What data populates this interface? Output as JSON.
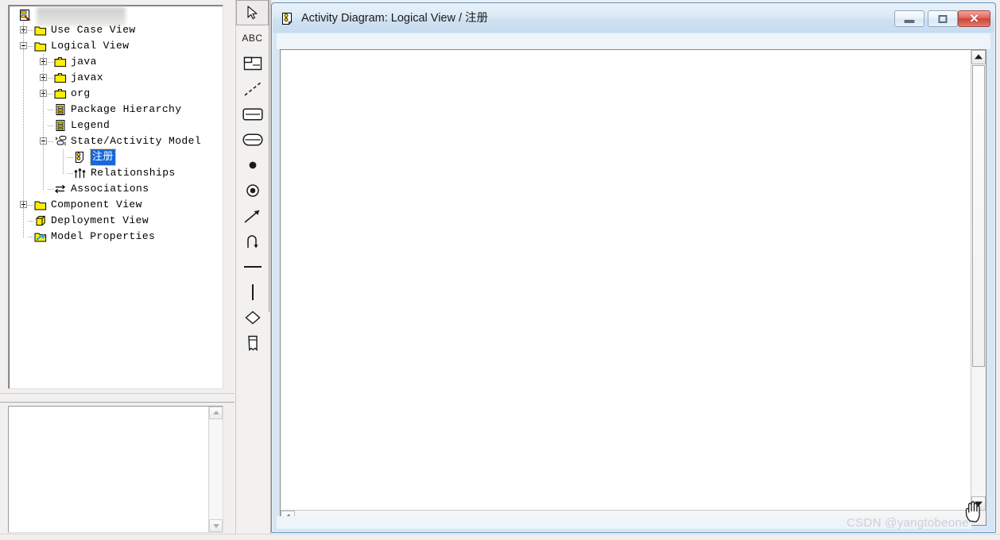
{
  "app": {
    "watermark": "CSDN @yangtobeone~"
  },
  "browser": {
    "root_label": "",
    "tree": [
      {
        "label": "Use Case View",
        "indent": 0,
        "expander": "plus",
        "icon": "folder-icon"
      },
      {
        "label": "Logical View",
        "indent": 0,
        "expander": "minus",
        "icon": "folder-icon"
      },
      {
        "label": "java",
        "indent": 1,
        "expander": "plus",
        "icon": "package-folder-icon"
      },
      {
        "label": "javax",
        "indent": 1,
        "expander": "plus",
        "icon": "package-folder-icon"
      },
      {
        "label": "org",
        "indent": 1,
        "expander": "plus",
        "icon": "package-folder-icon"
      },
      {
        "label": "Package Hierarchy",
        "indent": 1,
        "expander": "none",
        "icon": "class-diagram-icon"
      },
      {
        "label": "Legend",
        "indent": 1,
        "expander": "none",
        "icon": "class-diagram-icon"
      },
      {
        "label": "State/Activity Model",
        "indent": 1,
        "expander": "minus",
        "icon": "state-machine-icon"
      },
      {
        "label": "注册",
        "indent": 2,
        "expander": "none",
        "icon": "activity-diagram-icon",
        "selected": true
      },
      {
        "label": "Relationships",
        "indent": 2,
        "expander": "none",
        "icon": "relationships-icon"
      },
      {
        "label": "Associations",
        "indent": 1,
        "expander": "none",
        "icon": "associations-icon"
      },
      {
        "label": "Component View",
        "indent": 0,
        "expander": "plus",
        "icon": "folder-icon"
      },
      {
        "label": "Deployment View",
        "indent": 0,
        "expander": "none",
        "icon": "deployment-icon"
      },
      {
        "label": "Model Properties",
        "indent": 0,
        "expander": "none",
        "icon": "model-properties-icon"
      }
    ]
  },
  "documentation_panel": {
    "text": ""
  },
  "palette": {
    "tools": [
      {
        "name": "selection-tool",
        "icon": "arrow-pointer-icon",
        "label": "",
        "active": true
      },
      {
        "name": "text-tool",
        "icon": "abc-text-icon",
        "label": "ABC",
        "active": false
      },
      {
        "name": "note-tool",
        "icon": "note-icon",
        "label": "",
        "active": false
      },
      {
        "name": "note-anchor-tool",
        "icon": "dashed-line-icon",
        "label": "",
        "active": false
      },
      {
        "name": "state-tool",
        "icon": "rounded-state-icon",
        "label": "",
        "active": false
      },
      {
        "name": "activity-tool",
        "icon": "activity-oval-icon",
        "label": "",
        "active": false
      },
      {
        "name": "start-state-tool",
        "icon": "filled-dot-icon",
        "label": "",
        "active": false
      },
      {
        "name": "end-state-tool",
        "icon": "bullseye-icon",
        "label": "",
        "active": false
      },
      {
        "name": "state-transition-tool",
        "icon": "arrow-diagonal-icon",
        "label": "",
        "active": false
      },
      {
        "name": "transition-to-self-tool",
        "icon": "loop-arrow-icon",
        "label": "",
        "active": false
      },
      {
        "name": "horizontal-synchronization-tool",
        "icon": "horizontal-bar-icon",
        "label": "",
        "active": false
      },
      {
        "name": "vertical-synchronization-tool",
        "icon": "vertical-bar-icon",
        "label": "",
        "active": false
      },
      {
        "name": "decision-tool",
        "icon": "diamond-icon",
        "label": "",
        "active": false
      },
      {
        "name": "swimlane-tool",
        "icon": "swimlane-icon",
        "label": "",
        "active": false
      }
    ]
  },
  "diagram_window": {
    "title": "Activity Diagram: Logical View / 注册",
    "icon": "activity-diagram-icon",
    "buttons": {
      "minimize": "Minimize",
      "maximize": "Maximize",
      "close": "Close"
    },
    "canvas": {
      "content": ""
    }
  },
  "colors": {
    "title_bar_start": "#e9f2fa",
    "title_bar_end": "#c7dcf0",
    "window_border": "#5d93c4",
    "selection_blue": "#1668d8",
    "focus_orange": "#e09a30",
    "close_red": "#cf4434",
    "folder_yellow": "#ffee00"
  }
}
